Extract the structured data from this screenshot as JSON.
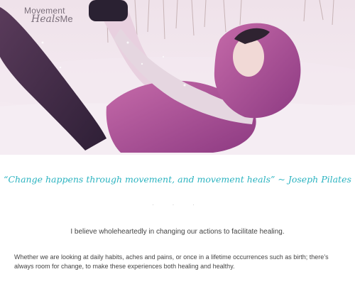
{
  "logo": {
    "line1": "Movement",
    "line2_script": "Heals",
    "line2_rest": "Me"
  },
  "hero": {
    "image_alt": ""
  },
  "content": {
    "quote": "“Change happens through movement, and movement heals” ~ Joseph Pilates",
    "separator": ". . .",
    "statement": "I believe wholeheartedly in changing our actions to facilitate healing.",
    "paragraph": "Whether we are looking at daily habits, aches and pains, or once in a lifetime occurrences such as birth; there’s always room for change, to make these experiences both healing and healthy."
  },
  "colors": {
    "accent_teal": "#2bb3c0",
    "hoodie_purple": "#a0458f",
    "snow": "#f4ecf3"
  }
}
